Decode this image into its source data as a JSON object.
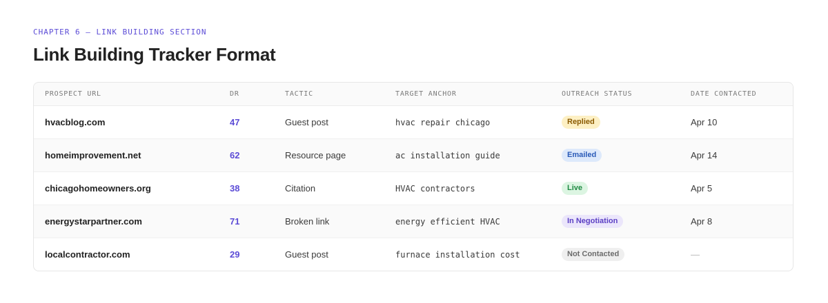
{
  "section": {
    "eyebrow": "CHAPTER 6 — LINK BUILDING SECTION",
    "title": "Link Building Tracker Format"
  },
  "table": {
    "headers": [
      "PROSPECT URL",
      "DR",
      "TACTIC",
      "TARGET ANCHOR",
      "OUTREACH STATUS",
      "DATE CONTACTED"
    ],
    "rows": [
      {
        "url": "hvacblog.com",
        "dr": "47",
        "tactic": "Guest post",
        "anchor": "hvac repair chicago",
        "status": "Replied",
        "status_type": "replied",
        "date": "Apr 10"
      },
      {
        "url": "homeimprovement.net",
        "dr": "62",
        "tactic": "Resource page",
        "anchor": "ac installation guide",
        "status": "Emailed",
        "status_type": "emailed",
        "date": "Apr 14"
      },
      {
        "url": "chicagohomeowners.org",
        "dr": "38",
        "tactic": "Citation",
        "anchor": "HVAC contractors",
        "status": "Live",
        "status_type": "live",
        "date": "Apr 5"
      },
      {
        "url": "energystarpartner.com",
        "dr": "71",
        "tactic": "Broken link",
        "anchor": "energy efficient HVAC",
        "status": "In Negotiation",
        "status_type": "negotiation",
        "date": "Apr 8"
      },
      {
        "url": "localcontractor.com",
        "dr": "29",
        "tactic": "Guest post",
        "anchor": "furnace installation cost",
        "status": "Not Contacted",
        "status_type": "not-contacted",
        "date": "—"
      }
    ]
  },
  "colors": {
    "accent": "#5b4bd6",
    "replied": "#fdf0c4",
    "emailed": "#dde9fb",
    "live": "#dcf5e2",
    "negotiation": "#ebe6fb",
    "not_contacted": "#efefef"
  }
}
